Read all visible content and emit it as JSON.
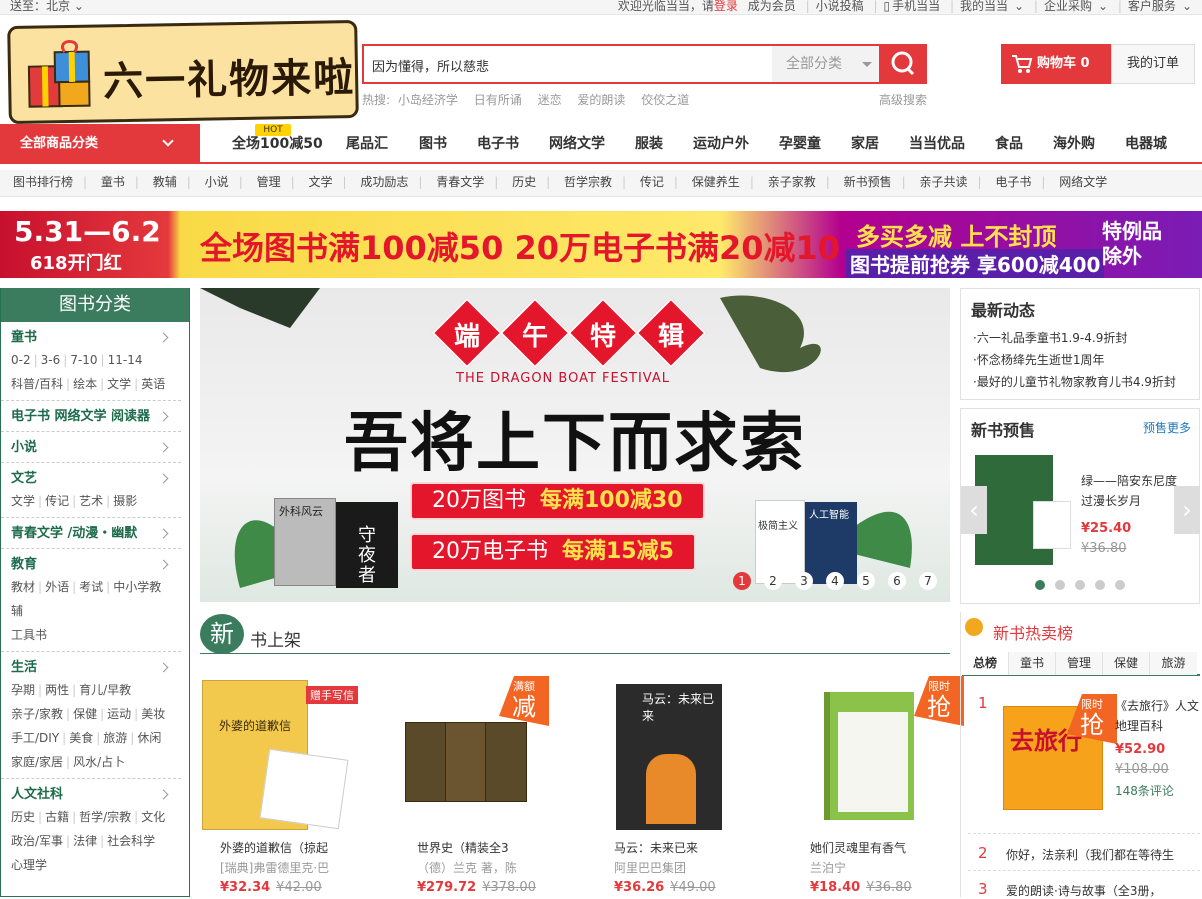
{
  "topbar": {
    "ship_to": "送至：北京",
    "welcome_prefix": "欢迎光临当当，请",
    "login": "登录",
    "register": "成为会员",
    "items": [
      "小说投稿",
      "手机当当",
      "我的当当",
      "企业采购",
      "客户服务"
    ]
  },
  "logo": {
    "text": "六一礼物来啦"
  },
  "search": {
    "value": "因为懂得，所以慈悲",
    "category": "全部分类",
    "hot_label": "热搜:",
    "hot_terms": [
      "小岛经济学",
      "日有所诵",
      "迷恋",
      "爱的朗读",
      "佼佼之道"
    ],
    "advanced": "高级搜索"
  },
  "cart": {
    "label": "购物车",
    "count": "0"
  },
  "orders_label": "我的订单",
  "nav": {
    "all_categories": "全部商品分类",
    "hot_badge": "HOT",
    "items": [
      "全场100减50",
      "尾品汇",
      "图书",
      "电子书",
      "网络文学",
      "服装",
      "运动户外",
      "孕婴童",
      "家居",
      "当当优品",
      "食品",
      "海外购",
      "电器城"
    ]
  },
  "subnav": [
    "图书排行榜",
    "童书",
    "教辅",
    "小说",
    "管理",
    "文学",
    "成功励志",
    "青春文学",
    "历史",
    "哲学宗教",
    "传记",
    "保健养生",
    "亲子家教",
    "新书预售",
    "亲子共读",
    "电子书",
    "网络文学"
  ],
  "banner": {
    "date": "5.31—6.2",
    "event": "618开门红",
    "main": "全场图书满100减50  20万电子书满20减10",
    "promo1": "多买多减 上不封顶",
    "promo2": "图书提前抢券 享600减400",
    "promo3": "特例品除外"
  },
  "sidebar": {
    "title": "图书分类",
    "sections": [
      {
        "title": "童书",
        "links": [
          "0-2",
          "3-6",
          "7-10",
          "11-14",
          "科普/百科",
          "绘本",
          "文学",
          "英语"
        ]
      },
      {
        "title": "电子书 网络文学 阅读器",
        "links": []
      },
      {
        "title": "小说",
        "links": []
      },
      {
        "title": "文艺",
        "links": [
          "文学",
          "传记",
          "艺术",
          "摄影"
        ]
      },
      {
        "title": "青春文学 /动漫・幽默",
        "links": []
      },
      {
        "title": "教育",
        "links": [
          "教材",
          "外语",
          "考试",
          "中小学教辅",
          "工具书"
        ]
      },
      {
        "title": "生活",
        "links": [
          "孕期",
          "两性",
          "育儿/早教",
          "亲子/家教",
          "保健",
          "运动",
          "美妆",
          "手工/DIY",
          "美食",
          "旅游",
          "休闲",
          "家庭/家居",
          "风水/占卜"
        ]
      },
      {
        "title": "人文社科",
        "links": [
          "历史",
          "古籍",
          "哲学/宗教",
          "文化",
          "政治/军事",
          "法律",
          "社会科学",
          "心理学"
        ]
      }
    ]
  },
  "carousel": {
    "chars": [
      "端",
      "午",
      "特",
      "辑"
    ],
    "en_title": "THE DRAGON BOAT FESTIVAL",
    "headline": "吾将上下而求索",
    "promo_a_prefix": "20万图书",
    "promo_a_value": "每满100减30",
    "promo_b_prefix": "20万电子书",
    "promo_b_value": "每满15减5",
    "book_labels": [
      "外科风云",
      "守夜者",
      "极简主义",
      "人工智能"
    ],
    "pages": [
      "1",
      "2",
      "3",
      "4",
      "5",
      "6",
      "7"
    ]
  },
  "new_books": {
    "circle": "新",
    "title": "书上架",
    "items": [
      {
        "name": "外婆的道歉信（掠起",
        "author": "[瑞典]弗雷德里克·巴",
        "price": "¥32.34",
        "orig": "¥42.00",
        "tag_small": "赠手写信",
        "tag_big": ""
      },
      {
        "name": "世界史（精装全3",
        "author": "（德）兰克 著，陈",
        "price": "¥279.72",
        "orig": "¥378.00",
        "tag_small": "满额",
        "tag_big": "减"
      },
      {
        "name": "马云：未来已来",
        "author": "阿里巴巴集团",
        "price": "¥36.26",
        "orig": "¥49.00",
        "tag_small": "",
        "tag_big": ""
      },
      {
        "name": "她们灵魂里有香气",
        "author": "兰泊宁",
        "price": "¥18.40",
        "orig": "¥36.80",
        "tag_small": "限时",
        "tag_big": "抢"
      }
    ]
  },
  "cover_texts": {
    "b1": "外婆的道歉信",
    "b3": "马云：未来已来"
  },
  "news": {
    "title": "最新动态",
    "items": [
      "六一礼品季童书1.9-4.9折封",
      "怀念杨绛先生逝世1周年",
      "最好的儿童节礼物家教育儿书4.9折封"
    ]
  },
  "presale": {
    "title": "新书预售",
    "more": "预售更多",
    "book_name": "绿——陪安东尼度过漫长岁月",
    "price": "¥25.40",
    "orig": "¥36.80"
  },
  "hotlist": {
    "title": "新书热卖榜",
    "tabs": [
      "总榜",
      "童书",
      "管理",
      "保健",
      "旅游"
    ],
    "items": [
      {
        "rank": "1",
        "name": "《去旅行》人文地理百科",
        "price": "¥52.90",
        "orig": "¥108.00",
        "comments": "148条评论",
        "tag_small": "限时",
        "tag_big": "抢",
        "cover": "去旅行"
      },
      {
        "rank": "2",
        "name": "你好，法亲利（我们都在等待生"
      },
      {
        "rank": "3",
        "name": "爱的朗读·诗与故事（全3册，"
      }
    ]
  },
  "colors": {
    "brand_red": "#e4393c",
    "green": "#3b7c5f"
  }
}
